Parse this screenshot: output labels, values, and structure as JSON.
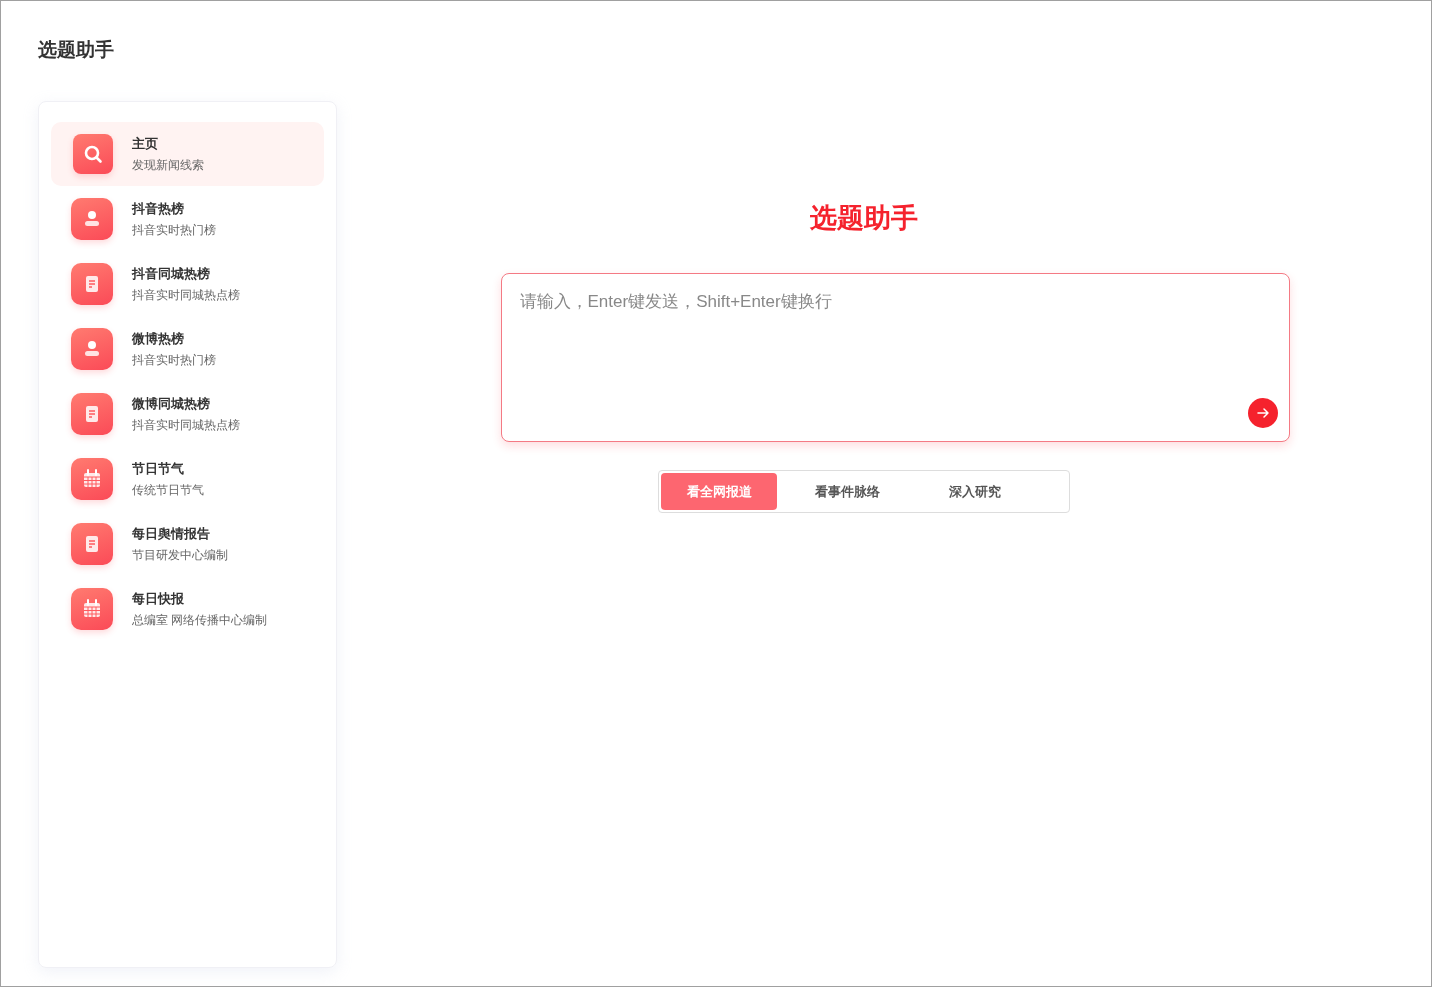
{
  "app_title": "选题助手",
  "sidebar": {
    "items": [
      {
        "title": "主页",
        "subtitle": "发现新闻线索",
        "kind": "search",
        "selected": true
      },
      {
        "title": "抖音热榜",
        "subtitle": "抖音实时热门榜",
        "kind": "person",
        "selected": false
      },
      {
        "title": "抖音同城热榜",
        "subtitle": "抖音实时同城热点榜",
        "kind": "document",
        "selected": false
      },
      {
        "title": "微博热榜",
        "subtitle": "抖音实时热门榜",
        "kind": "person",
        "selected": false
      },
      {
        "title": "微博同城热榜",
        "subtitle": "抖音实时同城热点榜",
        "kind": "document",
        "selected": false
      },
      {
        "title": "节日节气",
        "subtitle": "传统节日节气",
        "kind": "calendar",
        "selected": false
      },
      {
        "title": "每日舆情报告",
        "subtitle": "节目研发中心编制",
        "kind": "document",
        "selected": false
      },
      {
        "title": "每日快报",
        "subtitle": "总编室 网络传播中心编制",
        "kind": "calendar",
        "selected": false
      }
    ]
  },
  "main": {
    "heading": "选题助手",
    "input": {
      "placeholder": "请输入，Enter键发送，Shift+Enter键换行"
    },
    "modes": [
      {
        "label": "看全网报道",
        "selected": true
      },
      {
        "label": "看事件脉络",
        "selected": false
      },
      {
        "label": "深入研究",
        "selected": false
      }
    ]
  }
}
